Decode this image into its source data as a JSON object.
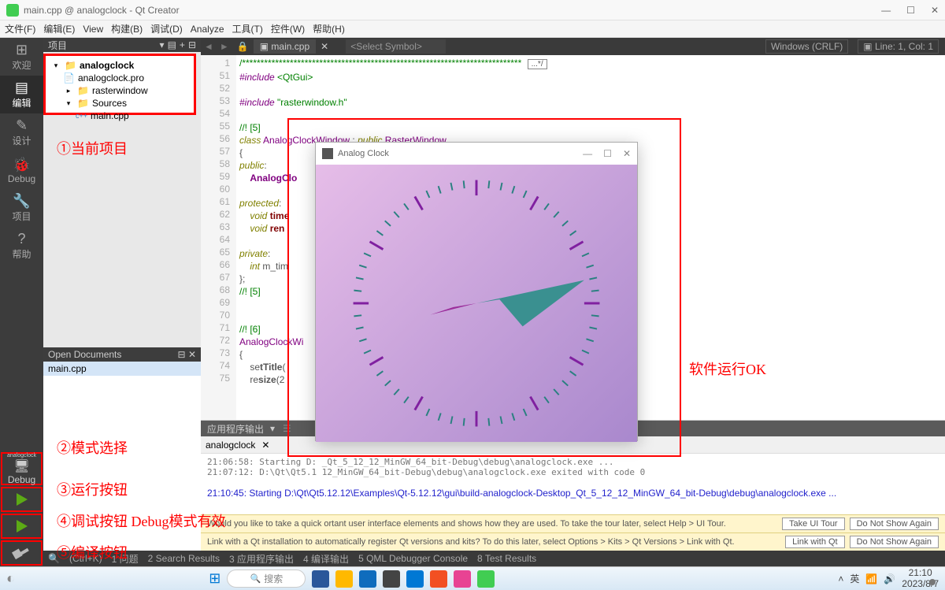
{
  "window": {
    "title": "main.cpp @ analogclock - Qt Creator"
  },
  "menus": [
    "文件(F)",
    "编辑(E)",
    "View",
    "构建(B)",
    "调试(D)",
    "Analyze",
    "工具(T)",
    "控件(W)",
    "帮助(H)"
  ],
  "modes": [
    {
      "label": "欢迎",
      "icon": "⊞"
    },
    {
      "label": "编辑",
      "icon": "▤",
      "active": true
    },
    {
      "label": "设计",
      "icon": "✎"
    },
    {
      "label": "Debug",
      "icon": "⛯"
    },
    {
      "label": "项目",
      "icon": "🔧"
    },
    {
      "label": "帮助",
      "icon": "?"
    }
  ],
  "kit": {
    "project": "analogclock",
    "mode": "Debug"
  },
  "project_header": "项目",
  "tree": {
    "root": "analogclock",
    "items": [
      "analogclock.pro",
      "rasterwindow",
      "Sources"
    ],
    "source_child": "main.cpp"
  },
  "open_docs_header": "Open Documents",
  "open_doc": "main.cpp",
  "editor": {
    "tab": "main.cpp",
    "symbol_placeholder": "<Select Symbol>",
    "encoding": "Windows (CRLF)",
    "pos": "Line: 1, Col: 1",
    "dots": "...*/",
    "gutter_start": 1,
    "lines": [
      {
        "n": 1,
        "html": "<span class='c-comment'>/****************************************************************************</span> <span class='dots-box' data-name='fold-marker'>...*/</span>"
      },
      {
        "n": 51,
        "html": "<span class='c-keyword c-type'>#include</span> <span class='c-string'>&lt;QtGui&gt;</span>"
      },
      {
        "n": 52,
        "html": ""
      },
      {
        "n": 53,
        "html": "<span class='c-keyword c-type'>#include</span> <span class='c-string'>\"rasterwindow.h\"</span>"
      },
      {
        "n": 54,
        "html": ""
      },
      {
        "n": 55,
        "html": "<span class='c-comment'>//! [5]</span>"
      },
      {
        "n": 56,
        "html": "<span class='c-keyword'>class</span> <span class='c-type'>AnalogClockWindow</span> : <span class='c-keyword'>public</span> <span class='c-type'>RasterWindow</span>"
      },
      {
        "n": 57,
        "html": "{"
      },
      {
        "n": 58,
        "html": "<span class='c-keyword'>public</span>:"
      },
      {
        "n": 59,
        "html": "    <span class='c-type c-bold'>AnalogClo</span>"
      },
      {
        "n": 60,
        "html": ""
      },
      {
        "n": 61,
        "html": "<span class='c-keyword'>protected</span>:"
      },
      {
        "n": 62,
        "html": "    <span class='c-keyword'>void</span> <span class='c-member c-bold'>time</span>"
      },
      {
        "n": 63,
        "html": "    <span class='c-keyword'>void</span> <span class='c-member c-bold'>ren</span>"
      },
      {
        "n": 64,
        "html": ""
      },
      {
        "n": 65,
        "html": "<span class='c-keyword'>private</span>:"
      },
      {
        "n": 66,
        "html": "    <span class='c-keyword'>int</span> m_tim"
      },
      {
        "n": 67,
        "html": "};"
      },
      {
        "n": 68,
        "html": "<span class='c-comment'>//! [5]</span>"
      },
      {
        "n": 69,
        "html": ""
      },
      {
        "n": 70,
        "html": ""
      },
      {
        "n": 71,
        "html": "<span class='c-comment'>//! [6]</span>"
      },
      {
        "n": 72,
        "html": "<span class='c-type'>AnalogClockWi</span>"
      },
      {
        "n": 73,
        "html": "{"
      },
      {
        "n": 74,
        "html": "    se<span class='c-bold'>tTitle</span>("
      },
      {
        "n": 75,
        "html": "    re<span class='c-bold'>size</span>(2"
      }
    ]
  },
  "clock": {
    "title": "Analog Clock"
  },
  "output": {
    "tab": "应用程序输出",
    "run_name": "analogclock",
    "lines": [
      "21:06:58: Starting D:                                                        _Qt_5_12_12_MinGW_64_bit-Debug\\debug\\analogclock.exe ...",
      "21:07:12: D:\\Qt\\Qt5.1                                                        12_MinGW_64_bit-Debug\\debug\\analogclock.exe exited with code 0",
      "",
      "21:10:45: Starting D:\\Qt\\Qt5.12.12\\Examples\\Qt-5.12.12\\gui\\build-analogclock-Desktop_Qt_5_12_12_MinGW_64_bit-Debug\\debug\\analogclock.exe ..."
    ]
  },
  "notifications": [
    {
      "text": "Would you like to take a quick                             ortant user interface elements and shows how they are used. To take the tour later, select Help > UI Tour.",
      "b1": "Take UI Tour",
      "b2": "Do Not Show Again"
    },
    {
      "text": "Link with a Qt installation to automatically register Qt versions and kits? To do this later, select Options > Kits > Qt Versions > Link with Qt.",
      "b1": "Link with Qt",
      "b2": "Do Not Show Again"
    }
  ],
  "statusbar": {
    "shortcut": "(Ctrl+K)",
    "items": [
      "1 问题",
      "2 Search Results",
      "3 应用程序输出",
      "4 编译输出",
      "5 QML Debugger Console",
      "8 Test Results"
    ]
  },
  "taskbar": {
    "search": "搜索",
    "time": "21:10",
    "date": "2023/8/7",
    "ime": "英"
  },
  "annotations": {
    "a1": "①当前项目",
    "a2": "②模式选择",
    "a3": "③运行按钮",
    "a4": "④调试按钮  Debug模式有效",
    "a5": "⑤编译按钮",
    "ok": "软件运行OK"
  }
}
